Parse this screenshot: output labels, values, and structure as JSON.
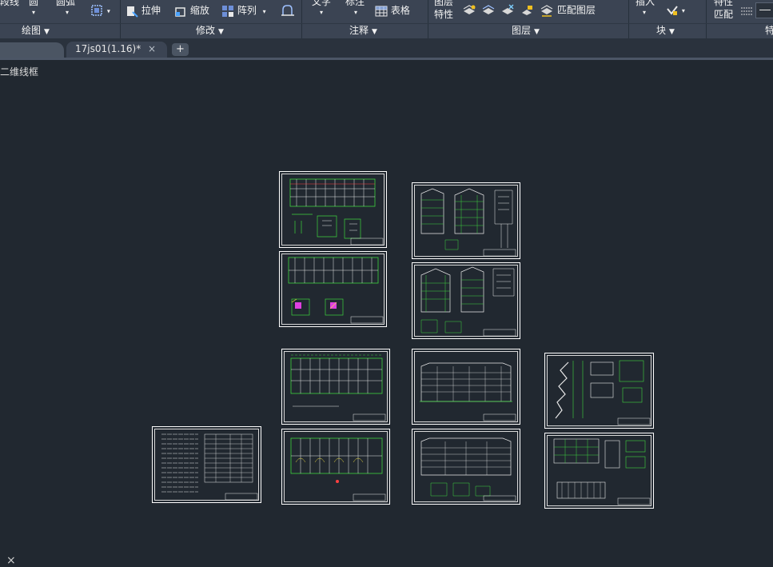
{
  "ribbon": {
    "draw_items": {
      "polyline": "段线",
      "circle": "圆",
      "arc": "圆弧"
    },
    "modify_items": {
      "stretch": "拉伸",
      "scale": "缩放",
      "array": "阵列"
    },
    "annotation_items": {
      "text": "文字",
      "dimension": "标注",
      "table": "表格"
    },
    "layer_items": {
      "layer_properties_l1": "图层",
      "layer_properties_l2": "特性",
      "match_layer": "匹配图层"
    },
    "block_items": {
      "insert": "插入"
    },
    "properties_items": {
      "match_l1": "特性",
      "match_l2": "匹配"
    },
    "panels": {
      "draw": "绘图",
      "modify": "修改",
      "annotation": "注释",
      "layers": "图层",
      "block": "块",
      "properties": "特"
    }
  },
  "tabs": {
    "active_file": "17js01(1.16)*",
    "close_glyph": "×",
    "new_glyph": "+"
  },
  "viewport": {
    "label": "二维线框"
  },
  "colors": {
    "background": "#212830",
    "ribbon": "#3b4453",
    "sheet_border": "#ffffff",
    "drawing_green": "#3ed43e",
    "highlight_magenta": "#e040e0",
    "highlight_yellow": "#f0e040"
  },
  "sheets": [
    "sheet-1",
    "sheet-2",
    "sheet-3",
    "sheet-4",
    "sheet-5",
    "sheet-6",
    "sheet-7",
    "sheet-8",
    "sheet-9",
    "sheet-10",
    "sheet-11",
    "sheet-12",
    "sheet-13"
  ]
}
